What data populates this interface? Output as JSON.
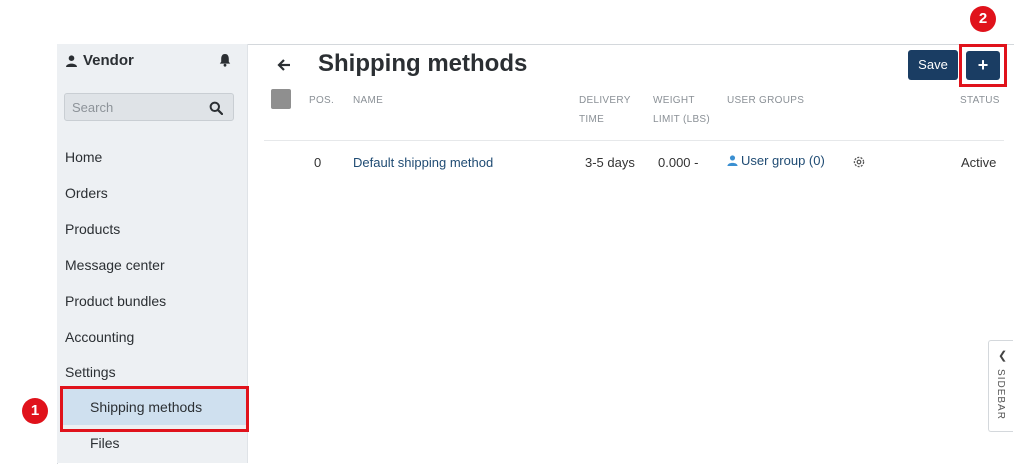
{
  "sidebar": {
    "vendor_label": "Vendor",
    "search_placeholder": "Search",
    "items": [
      {
        "label": "Home"
      },
      {
        "label": "Orders"
      },
      {
        "label": "Products"
      },
      {
        "label": "Message center"
      },
      {
        "label": "Product bundles"
      },
      {
        "label": "Accounting"
      },
      {
        "label": "Settings"
      }
    ],
    "sub_items": [
      {
        "label": "Shipping methods",
        "active": true
      },
      {
        "label": "Files"
      }
    ]
  },
  "header": {
    "title": "Shipping methods",
    "save_label": "Save",
    "add_label": "+"
  },
  "table": {
    "headers": {
      "pos": "POS.",
      "name": "NAME",
      "delivery_1": "DELIVERY",
      "delivery_2": "TIME",
      "weight_1": "WEIGHT",
      "weight_2": "LIMIT (LBS)",
      "user_groups": "USER GROUPS",
      "status": "STATUS"
    },
    "rows": [
      {
        "pos": "0",
        "name": "Default shipping method",
        "delivery": "3-5 days",
        "weight": "0.000 -",
        "user_group": "User group (0)",
        "status": "Active"
      }
    ]
  },
  "annotations": {
    "badge_1": "1",
    "badge_2": "2"
  },
  "side_tab": {
    "label": "SIDEBAR"
  },
  "colors": {
    "primary": "#1a3d63",
    "highlight": "#e0121b",
    "active_bg": "#cfe0ef",
    "sidebar_bg": "#edf0f3"
  }
}
